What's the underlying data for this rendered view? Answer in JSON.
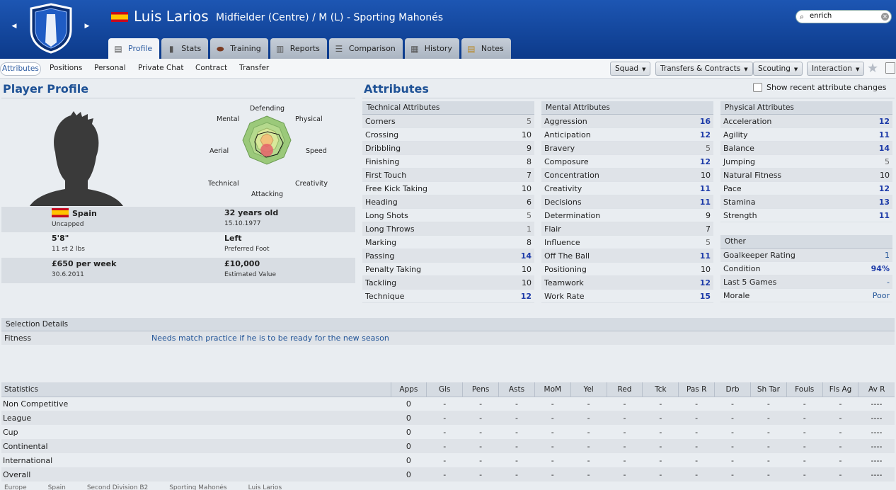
{
  "header": {
    "player_name": "Luis Larios",
    "subtitle": "Midfielder (Centre) / M (L) - Sporting Mahonés",
    "search_value": "enrich"
  },
  "main_tabs": [
    {
      "label": "Profile",
      "icon": "profile-card-icon",
      "active": true
    },
    {
      "label": "Stats",
      "icon": "bar-chart-icon"
    },
    {
      "label": "Training",
      "icon": "ball-icon"
    },
    {
      "label": "Reports",
      "icon": "report-icon"
    },
    {
      "label": "Comparison",
      "icon": "comparison-icon"
    },
    {
      "label": "History",
      "icon": "history-icon"
    },
    {
      "label": "Notes",
      "icon": "notes-icon"
    }
  ],
  "sub_tabs": [
    "Attributes",
    "Positions",
    "Personal",
    "Private Chat",
    "Contract",
    "Transfer"
  ],
  "menus": [
    "Squad",
    "Transfers & Contracts",
    "Scouting",
    "Interaction"
  ],
  "profile": {
    "title": "Player Profile",
    "radar_labels": {
      "defending": "Defending",
      "physical": "Physical",
      "speed": "Speed",
      "creativity": "Creativity",
      "attacking": "Attacking",
      "technical": "Technical",
      "aerial": "Aerial",
      "mental": "Mental"
    },
    "nation": "Spain",
    "caps": "Uncapped",
    "age": "32 years old",
    "dob": "15.10.1977",
    "height": "5'8\"",
    "weight": "11 st 2 lbs",
    "foot": "Left",
    "foot_label": "Preferred Foot",
    "wage": "£650 per week",
    "contract_end": "30.6.2011",
    "value": "£10,000",
    "value_label": "Estimated Value"
  },
  "attributes": {
    "title": "Attributes",
    "recent_changes_label": "Show recent attribute changes",
    "technical": {
      "title": "Technical Attributes",
      "items": [
        {
          "name": "Corners",
          "value": "5"
        },
        {
          "name": "Crossing",
          "value": "10"
        },
        {
          "name": "Dribbling",
          "value": "9"
        },
        {
          "name": "Finishing",
          "value": "8"
        },
        {
          "name": "First Touch",
          "value": "7"
        },
        {
          "name": "Free Kick Taking",
          "value": "10"
        },
        {
          "name": "Heading",
          "value": "6"
        },
        {
          "name": "Long Shots",
          "value": "5"
        },
        {
          "name": "Long Throws",
          "value": "1"
        },
        {
          "name": "Marking",
          "value": "8"
        },
        {
          "name": "Passing",
          "value": "14"
        },
        {
          "name": "Penalty Taking",
          "value": "10"
        },
        {
          "name": "Tackling",
          "value": "10"
        },
        {
          "name": "Technique",
          "value": "12"
        }
      ]
    },
    "mental": {
      "title": "Mental Attributes",
      "items": [
        {
          "name": "Aggression",
          "value": "16"
        },
        {
          "name": "Anticipation",
          "value": "12"
        },
        {
          "name": "Bravery",
          "value": "5"
        },
        {
          "name": "Composure",
          "value": "12"
        },
        {
          "name": "Concentration",
          "value": "10"
        },
        {
          "name": "Creativity",
          "value": "11"
        },
        {
          "name": "Decisions",
          "value": "11"
        },
        {
          "name": "Determination",
          "value": "9"
        },
        {
          "name": "Flair",
          "value": "7"
        },
        {
          "name": "Influence",
          "value": "5"
        },
        {
          "name": "Off The Ball",
          "value": "11"
        },
        {
          "name": "Positioning",
          "value": "10"
        },
        {
          "name": "Teamwork",
          "value": "12"
        },
        {
          "name": "Work Rate",
          "value": "15"
        }
      ]
    },
    "physical": {
      "title": "Physical Attributes",
      "items": [
        {
          "name": "Acceleration",
          "value": "12"
        },
        {
          "name": "Agility",
          "value": "11"
        },
        {
          "name": "Balance",
          "value": "14"
        },
        {
          "name": "Jumping",
          "value": "5"
        },
        {
          "name": "Natural Fitness",
          "value": "10"
        },
        {
          "name": "Pace",
          "value": "12"
        },
        {
          "name": "Stamina",
          "value": "13"
        },
        {
          "name": "Strength",
          "value": "11"
        }
      ]
    },
    "other": {
      "title": "Other",
      "items": [
        {
          "name": "Goalkeeper Rating",
          "value": "1"
        },
        {
          "name": "Condition",
          "value": "94%"
        },
        {
          "name": "Last 5 Games",
          "value": "-"
        },
        {
          "name": "Morale",
          "value": "Poor"
        }
      ]
    }
  },
  "selection": {
    "title": "Selection Details",
    "label": "Fitness",
    "value": "Needs match practice if he is to be ready for the new season"
  },
  "statistics": {
    "columns": [
      "Statistics",
      "Apps",
      "Gls",
      "Pens",
      "Asts",
      "MoM",
      "Yel",
      "Red",
      "Tck",
      "Pas R",
      "Drb",
      "Sh Tar",
      "Fouls",
      "Fls Ag",
      "Av R"
    ],
    "rows": [
      [
        "Non Competitive",
        "0",
        "-",
        "-",
        "-",
        "-",
        "-",
        "-",
        "-",
        "-",
        "-",
        "-",
        "-",
        "-",
        "----"
      ],
      [
        "League",
        "0",
        "-",
        "-",
        "-",
        "-",
        "-",
        "-",
        "-",
        "-",
        "-",
        "-",
        "-",
        "-",
        "----"
      ],
      [
        "Cup",
        "0",
        "-",
        "-",
        "-",
        "-",
        "-",
        "-",
        "-",
        "-",
        "-",
        "-",
        "-",
        "-",
        "----"
      ],
      [
        "Continental",
        "0",
        "-",
        "-",
        "-",
        "-",
        "-",
        "-",
        "-",
        "-",
        "-",
        "-",
        "-",
        "-",
        "----"
      ],
      [
        "International",
        "0",
        "-",
        "-",
        "-",
        "-",
        "-",
        "-",
        "-",
        "-",
        "-",
        "-",
        "-",
        "-",
        "----"
      ],
      [
        "Overall",
        "0",
        "-",
        "-",
        "-",
        "-",
        "-",
        "-",
        "-",
        "-",
        "-",
        "-",
        "-",
        "-",
        "----"
      ]
    ]
  },
  "breadcrumb": [
    "Europe",
    "Spain",
    "Second Division B2",
    "Sporting Mahonés",
    "Luis Larios"
  ],
  "colors": {
    "header": "#1d56b3",
    "accent": "#1f5296",
    "high_value": "#1c3aa8"
  }
}
